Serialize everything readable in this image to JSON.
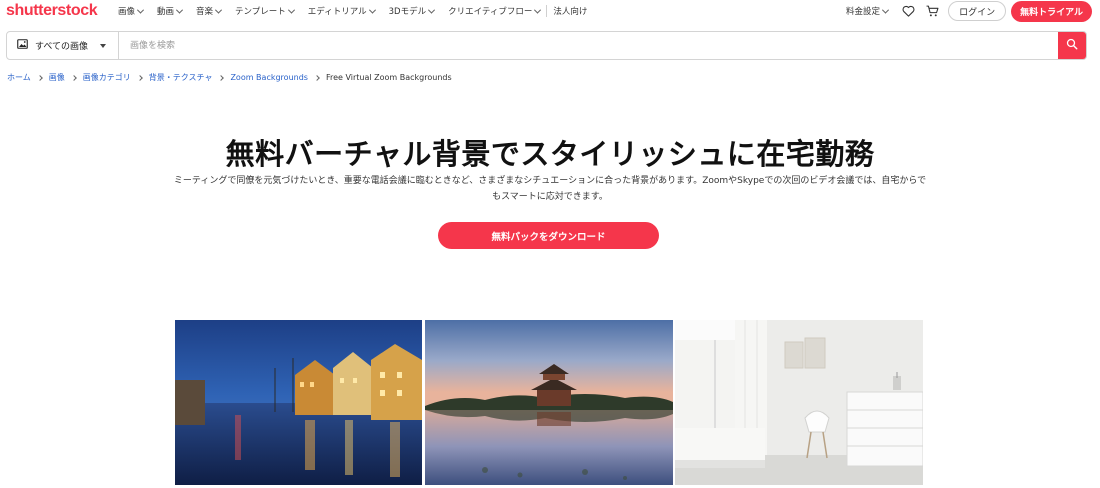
{
  "brand": {
    "logo_text": "shutterstock",
    "accent_color": "#f5364b"
  },
  "nav": {
    "items": [
      {
        "label": "画像"
      },
      {
        "label": "動画"
      },
      {
        "label": "音楽"
      },
      {
        "label": "テンプレート"
      },
      {
        "label": "エディトリアル"
      },
      {
        "label": "3Dモデル"
      },
      {
        "label": "クリエイティブフロー"
      }
    ],
    "enterprise_label": "法人向け",
    "pricing_label": "料金設定",
    "login_label": "ログイン",
    "trial_label": "無料トライアル",
    "favorites_icon": "heart-icon",
    "cart_icon": "cart-icon"
  },
  "search": {
    "type_label": "すべての画像",
    "placeholder": "画像を検索",
    "value": ""
  },
  "breadcrumb": [
    {
      "label": "ホーム"
    },
    {
      "label": "画像"
    },
    {
      "label": "画像カテゴリ"
    },
    {
      "label": "背景・テクスチャ"
    },
    {
      "label": "Zoom Backgrounds"
    },
    {
      "label": "Free Virtual Zoom Backgrounds"
    }
  ],
  "hero": {
    "title": "無料バーチャル背景でスタイリッシュに在宅勤務",
    "description": "ミーティングで同僚を元気づけたいとき、重要な電話会議に臨むときなど、さまざまなシチュエーションに合った背景があります。ZoomやSkypeでの次回のビデオ会議では、自宅からでもスマートに応対できます。",
    "cta_label": "無料パックをダウンロード"
  },
  "gallery": [
    {
      "subject": "night-canal-cityscape"
    },
    {
      "subject": "palace-tower-reflection"
    },
    {
      "subject": "white-bedroom-interior"
    }
  ]
}
